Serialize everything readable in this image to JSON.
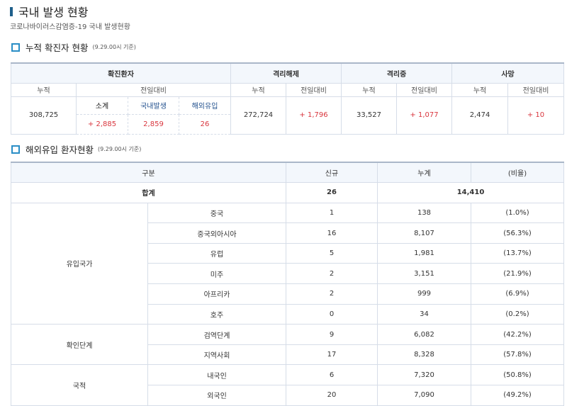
{
  "title": "국내 발생 현황",
  "subtitle": "코로나바이러스감염증-19 국내 발생현황",
  "section1": {
    "title": "누적 확진자 현황",
    "note": "(9.29.00시 기준)"
  },
  "section2": {
    "title": "해외유입 환자현황",
    "note": "(9.29.00시 기준)"
  },
  "summary": {
    "headers": {
      "confirmed": "확진환자",
      "released": "격리해제",
      "isolated": "격리중",
      "deaths": "사망"
    },
    "cum": "누적",
    "change": "전일대비",
    "subtotal": "소계",
    "domestic": "국내발생",
    "imported": "해외유입",
    "confirmed_cum": "308,725",
    "confirmed_sub": "+ 2,885",
    "confirmed_dom": "2,859",
    "confirmed_imp": "26",
    "released_cum": "272,724",
    "released_chg": "+ 1,796",
    "isolated_cum": "33,527",
    "isolated_chg": "+ 1,077",
    "deaths_cum": "2,474",
    "deaths_chg": "+ 10"
  },
  "imported": {
    "headers": [
      "구분",
      "신규",
      "누계",
      "(비율)"
    ],
    "total": {
      "label": "합계",
      "new": "26",
      "cum": "14,410"
    },
    "groups": [
      "유입국가",
      "확인단계",
      "국적"
    ],
    "rows": [
      {
        "name": "중국",
        "new": "1",
        "cum": "138",
        "ratio": "(1.0%)"
      },
      {
        "name": "중국외아시아",
        "new": "16",
        "cum": "8,107",
        "ratio": "(56.3%)"
      },
      {
        "name": "유럽",
        "new": "5",
        "cum": "1,981",
        "ratio": "(13.7%)"
      },
      {
        "name": "미주",
        "new": "2",
        "cum": "3,151",
        "ratio": "(21.9%)"
      },
      {
        "name": "아프리카",
        "new": "2",
        "cum": "999",
        "ratio": "(6.9%)"
      },
      {
        "name": "호주",
        "new": "0",
        "cum": "34",
        "ratio": "(0.2%)"
      },
      {
        "name": "검역단계",
        "new": "9",
        "cum": "6,082",
        "ratio": "(42.2%)"
      },
      {
        "name": "지역사회",
        "new": "17",
        "cum": "8,328",
        "ratio": "(57.8%)"
      },
      {
        "name": "내국인",
        "new": "6",
        "cum": "7,320",
        "ratio": "(50.8%)"
      },
      {
        "name": "외국인",
        "new": "20",
        "cum": "7,090",
        "ratio": "(49.2%)"
      }
    ]
  }
}
